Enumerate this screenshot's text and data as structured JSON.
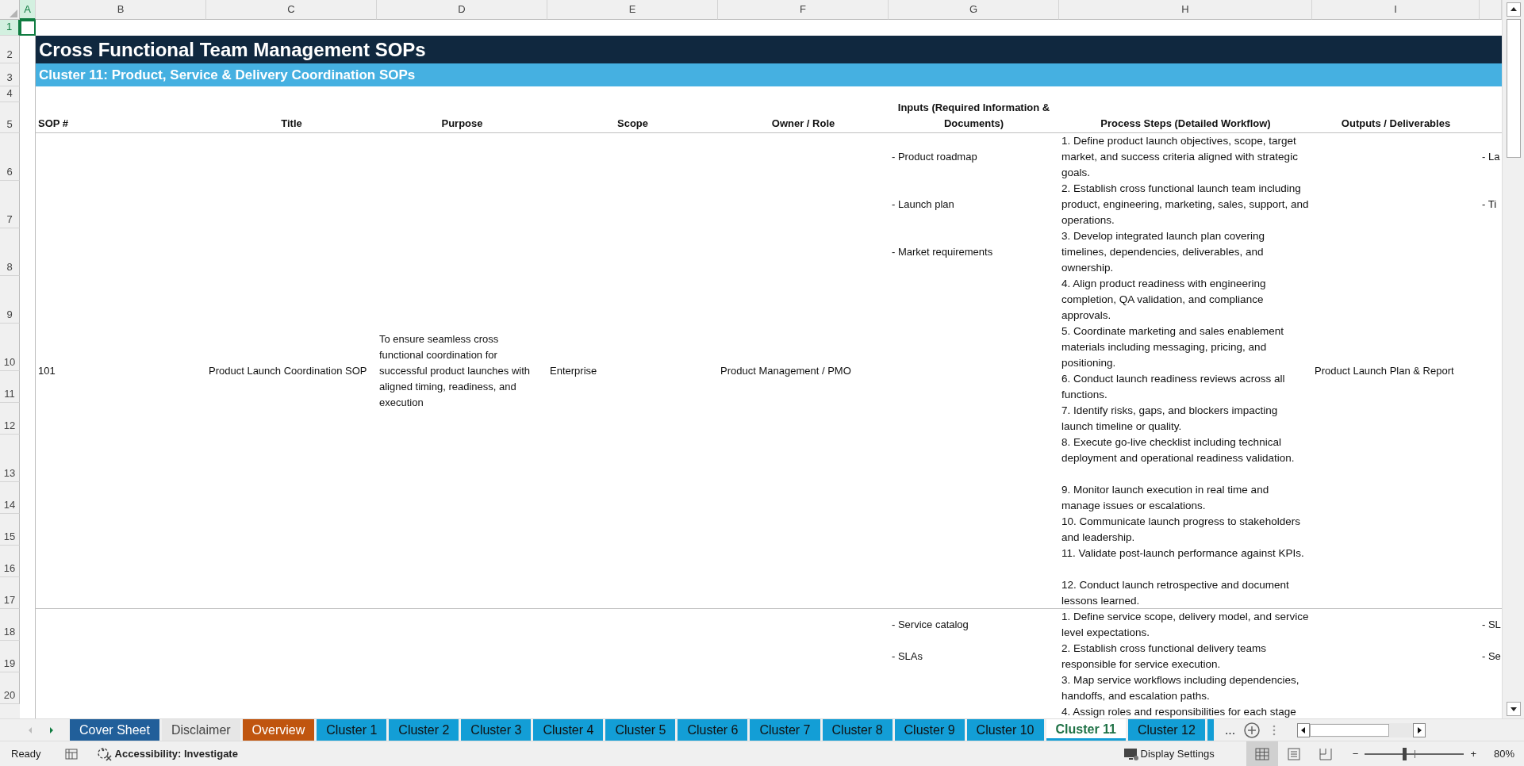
{
  "column_headers": [
    {
      "label": "A",
      "selected": true
    },
    {
      "label": "B",
      "selected": false
    },
    {
      "label": "C",
      "selected": false
    },
    {
      "label": "D",
      "selected": false
    },
    {
      "label": "E",
      "selected": false
    },
    {
      "label": "F",
      "selected": false
    },
    {
      "label": "G",
      "selected": false
    },
    {
      "label": "H",
      "selected": false
    },
    {
      "label": "I",
      "selected": false
    }
  ],
  "row_numbers": [
    {
      "label": "1",
      "selected": true
    },
    {
      "label": "2",
      "selected": false
    },
    {
      "label": "3",
      "selected": false
    },
    {
      "label": "4",
      "selected": false
    },
    {
      "label": "5",
      "selected": false
    },
    {
      "label": "6",
      "selected": false
    },
    {
      "label": "7",
      "selected": false
    },
    {
      "label": "8",
      "selected": false
    },
    {
      "label": "9",
      "selected": false
    },
    {
      "label": "10",
      "selected": false
    },
    {
      "label": "11",
      "selected": false
    },
    {
      "label": "12",
      "selected": false
    },
    {
      "label": "13",
      "selected": false
    },
    {
      "label": "14",
      "selected": false
    },
    {
      "label": "15",
      "selected": false
    },
    {
      "label": "16",
      "selected": false
    },
    {
      "label": "17",
      "selected": false
    },
    {
      "label": "18",
      "selected": false
    },
    {
      "label": "19",
      "selected": false
    },
    {
      "label": "20",
      "selected": false
    }
  ],
  "title": "Cross Functional Team Management SOPs",
  "subtitle": "Cluster 11: Product, Service & Delivery Coordination SOPs",
  "table": {
    "columns": [
      "SOP #",
      "Title",
      "Purpose",
      "Scope",
      "Owner / Role",
      "Inputs (Required Information & Documents)",
      "Process Steps (Detailed Workflow)",
      "Outputs / Deliverables"
    ],
    "records": [
      {
        "sop": "101",
        "title": "Product Launch Coordination SOP",
        "purpose": "To ensure seamless cross functional coordination for successful product launches with aligned timing, readiness, and execution",
        "scope": "Enterprise",
        "owner": "Product Management / PMO",
        "inputs": [
          "- Product roadmap",
          "- Launch plan",
          "- Market requirements"
        ],
        "steps": [
          "1. Define product launch objectives, scope, target market, and success criteria aligned with strategic goals.",
          "2. Establish cross functional launch team including product, engineering, marketing, sales, support, and operations.",
          "3. Develop integrated launch plan covering timelines, dependencies, deliverables, and ownership.",
          "4. Align product readiness with engineering completion, QA validation, and compliance approvals.",
          "5. Coordinate marketing and sales enablement materials including messaging, pricing, and positioning.",
          "6. Conduct launch readiness reviews across all functions.",
          "7. Identify risks, gaps, and blockers impacting launch timeline or quality.",
          "8. Execute go-live checklist including technical deployment and operational readiness validation.",
          "9. Monitor launch execution in real time and manage issues or escalations.",
          "10. Communicate launch progress to stakeholders and leadership.",
          "11. Validate post-launch performance against KPIs.",
          "12. Conduct launch retrospective and document lessons learned."
        ],
        "outputs": "Product Launch Plan & Report",
        "column_j": [
          "- La",
          "- Ti"
        ]
      },
      {
        "inputs": [
          "- Service catalog",
          "- SLAs"
        ],
        "steps": [
          "1. Define service scope, delivery model, and service level expectations.",
          "2. Establish cross functional delivery teams responsible for service execution.",
          "3. Map service workflows including dependencies, handoffs, and escalation paths.",
          "4. Assign roles and responsibilities for each stage"
        ],
        "column_j": [
          "- SL",
          "- Se"
        ]
      }
    ]
  },
  "sheet_tabs": [
    {
      "label": "Cover Sheet",
      "color": "#215f9a",
      "selected": false
    },
    {
      "label": "Disclaimer",
      "selected": false
    },
    {
      "label": "Overview",
      "color": "#c0550f",
      "selected": false
    },
    {
      "label": "Cluster 1",
      "color": "#139ed6",
      "selected": false
    },
    {
      "label": "Cluster 2",
      "color": "#139ed6",
      "selected": false
    },
    {
      "label": "Cluster 3",
      "color": "#139ed6",
      "selected": false
    },
    {
      "label": "Cluster 4",
      "color": "#139ed6",
      "selected": false
    },
    {
      "label": "Cluster 5",
      "color": "#139ed6",
      "selected": false
    },
    {
      "label": "Cluster 6",
      "color": "#139ed6",
      "selected": false
    },
    {
      "label": "Cluster 7",
      "color": "#139ed6",
      "selected": false
    },
    {
      "label": "Cluster 8",
      "color": "#139ed6",
      "selected": false
    },
    {
      "label": "Cluster 9",
      "color": "#139ed6",
      "selected": false
    },
    {
      "label": "Cluster 10",
      "color": "#139ed6",
      "selected": false
    },
    {
      "label": "Cluster 11",
      "color": "#139ed6",
      "selected": true
    },
    {
      "label": "Cluster 12",
      "color": "#139ed6",
      "selected": false
    }
  ],
  "more_tabs": "...",
  "status_bar": {
    "ready": "Ready",
    "accessibility": "Accessibility: Investigate",
    "display_settings": "Display Settings",
    "views": [
      {
        "kind": "normal",
        "selected": true
      },
      {
        "kind": "page_layout",
        "selected": false
      },
      {
        "kind": "page_break",
        "selected": false
      }
    ],
    "zoom": {
      "zoom_out": "−",
      "level": 0.4,
      "zoom_in": "+",
      "reading": "80%"
    }
  }
}
